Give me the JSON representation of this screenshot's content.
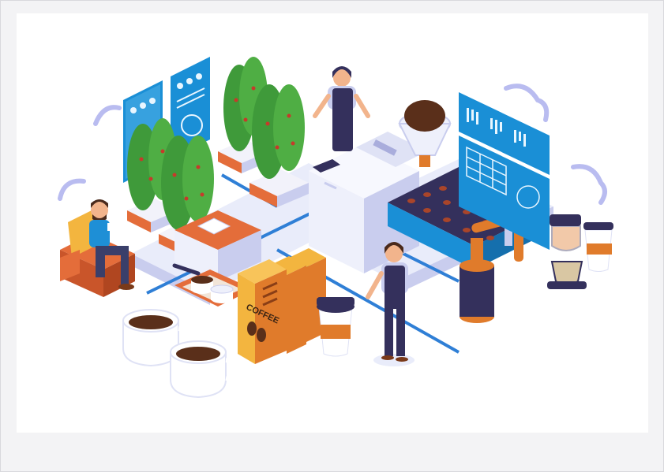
{
  "illustration": {
    "box_label": "COFFEE"
  },
  "colors": {
    "screen_blue": "#1a8fd6",
    "screen_light": "#6fc4f0",
    "machine_white": "#eef0fb",
    "machine_shadow": "#c9cdee",
    "floor": "#e9ecfa",
    "floor_stripe": "#2f7fd6",
    "leaf_green": "#3f9a3a",
    "berry_red": "#c63a2a",
    "planter": "#e46d3a",
    "box_yellow": "#f3b53f",
    "box_orange": "#e07b2b",
    "coffee": "#5a2f1a",
    "apron": "#34305c",
    "shirt": "#7b7fd0",
    "skin": "#f2b48c",
    "hair": "#4a2a1c"
  }
}
